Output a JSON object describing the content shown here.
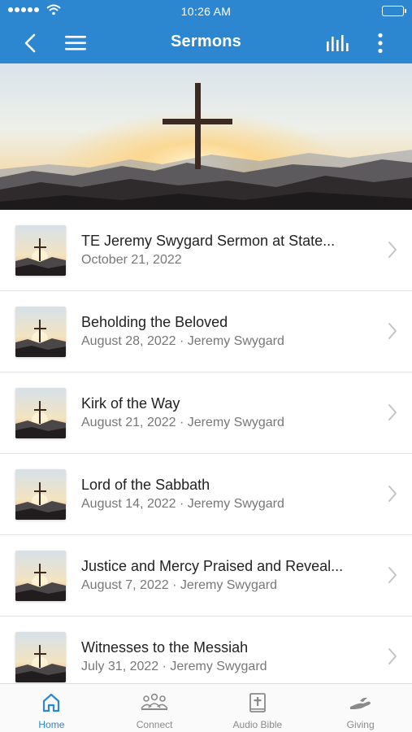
{
  "status_bar": {
    "time": "10:26 AM"
  },
  "nav": {
    "title": "Sermons",
    "back_icon": "chevron-left-icon",
    "menu_icon": "hamburger-menu-icon",
    "audio_icon": "audio-levels-icon",
    "more_icon": "vertical-dots-icon"
  },
  "colors": {
    "brand": "#2d86d0",
    "tab_inactive": "#8a8a8a"
  },
  "sermons": [
    {
      "title": "TE Jeremy Swygard Sermon at State...",
      "subtitle": "October 21, 2022"
    },
    {
      "title": "Beholding the Beloved",
      "subtitle": "August 28, 2022 · Jeremy Swygard"
    },
    {
      "title": "Kirk of the Way",
      "subtitle": "August 21, 2022 · Jeremy Swygard"
    },
    {
      "title": "Lord of the Sabbath",
      "subtitle": "August 14, 2022 · Jeremy Swygard"
    },
    {
      "title": "Justice and Mercy Praised and Reveal...",
      "subtitle": "August 7, 2022 · Jeremy Swygard"
    },
    {
      "title": "Witnesses to the Messiah",
      "subtitle": "July 31, 2022 · Jeremy Swygard"
    }
  ],
  "tabs": [
    {
      "label": "Home",
      "icon": "home-icon",
      "active": true
    },
    {
      "label": "Connect",
      "icon": "people-icon",
      "active": false
    },
    {
      "label": "Audio Bible",
      "icon": "bible-icon",
      "active": false
    },
    {
      "label": "Giving",
      "icon": "giving-hand-icon",
      "active": false
    }
  ]
}
